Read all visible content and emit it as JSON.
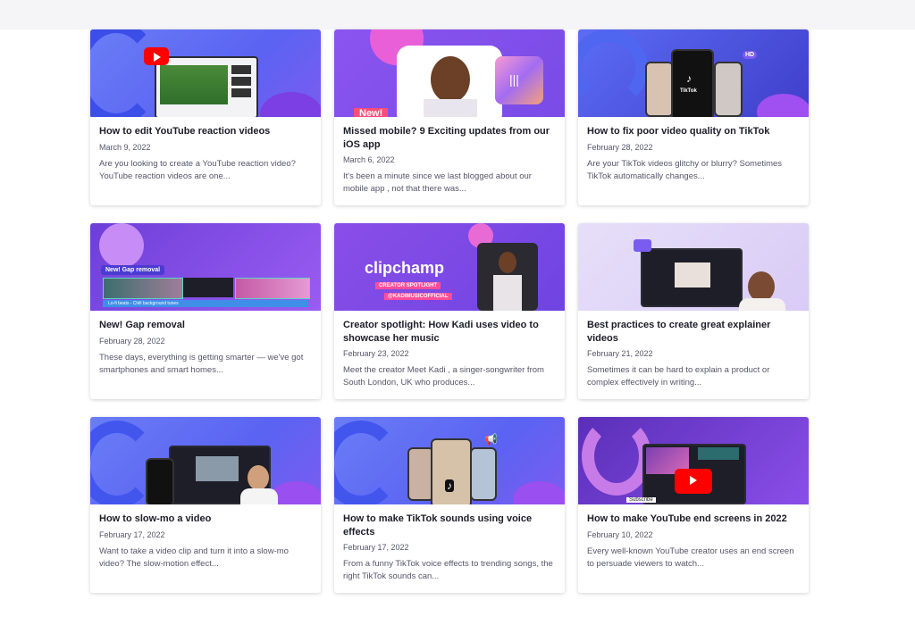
{
  "posts": [
    {
      "title": "How to edit YouTube reaction videos",
      "date": "March 9, 2022",
      "excerpt": "Are you looking to create a YouTube reaction video? YouTube reaction videos are one..."
    },
    {
      "title": "Missed mobile? 9 Exciting updates from our iOS app",
      "date": "March 6, 2022",
      "excerpt": "It's been a minute since we last blogged about our mobile app , not that there was..."
    },
    {
      "title": "How to fix poor video quality on TikTok",
      "date": "February 28, 2022",
      "excerpt": "Are your TikTok videos glitchy or blurry? Sometimes TikTok automatically changes..."
    },
    {
      "title": "New! Gap removal",
      "date": "February 28, 2022",
      "excerpt": "These days, everything is getting smarter — we've got smartphones and smart homes..."
    },
    {
      "title": "Creator spotlight: How Kadi uses video to showcase her music",
      "date": "February 23, 2022",
      "excerpt": "Meet the creator Meet Kadi , a singer-songwriter from South London, UK who produces..."
    },
    {
      "title": "Best practices to create great explainer videos",
      "date": "February 21, 2022",
      "excerpt": "Sometimes it can be hard to explain a product or complex effectively in writing..."
    },
    {
      "title": "How to slow-mo a video",
      "date": "February 17, 2022",
      "excerpt": "Want to take a video clip and turn it into a slow-mo video? The slow-motion effect..."
    },
    {
      "title": "How to make TikTok sounds using voice effects",
      "date": "February 17, 2022",
      "excerpt": "From a funny TikTok voice effects to trending songs, the right TikTok sounds can..."
    },
    {
      "title": "How to make YouTube end screens in 2022",
      "date": "February 10, 2022",
      "excerpt": "Every well-known YouTube creator uses an end screen to persuade viewers to watch..."
    }
  ],
  "thumbs": {
    "new_badge": "New!",
    "tiktok_label": "TikTok",
    "gap_label": "New! Gap removal",
    "track_label": "Lo-fi beats - Chill background tunes",
    "clipchamp_word": "clipchamp",
    "spotlight_label": "CREATOR SPOTLIGHT",
    "handle_label": "@KADIMUSICOFFICIAL",
    "hd_label": "HD",
    "subscribe_label": "Subscribe"
  }
}
